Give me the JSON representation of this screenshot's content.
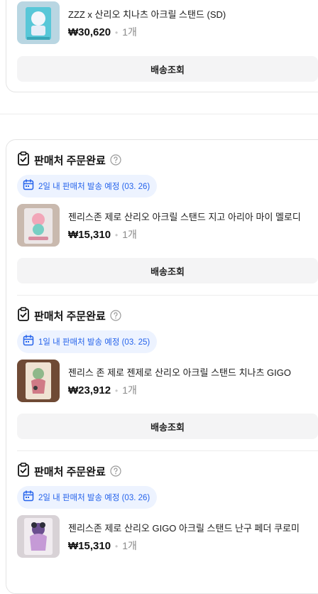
{
  "top_card": {
    "item": {
      "name": "ZZZ x 산리오 치나츠 아크릴 스탠드 (SD)",
      "price": "₩30,620",
      "qty": "1개"
    },
    "track_button": "배송조회"
  },
  "orders": [
    {
      "status": "판매처 주문완료",
      "shipping_note": "2일 내 판매처 발송 예정 (03. 26)",
      "item": {
        "name": "젠리스존 제로 산리오 아크릴 스탠드 지고 아리아 마이 멜로디",
        "price": "₩15,310",
        "qty": "1개"
      },
      "track_button": "배송조회"
    },
    {
      "status": "판매처 주문완료",
      "shipping_note": "1일 내 판매처 발송 예정 (03. 25)",
      "item": {
        "name": "젠리스 존 제로 젠제로 산리오 아크릴 스탠드 치나츠 GIGO",
        "price": "₩23,912",
        "qty": "1개"
      },
      "track_button": "배송조회"
    },
    {
      "status": "판매처 주문완료",
      "shipping_note": "2일 내 판매처 발송 예정 (03. 26)",
      "item": {
        "name": "젠리스존 제로 산리오 GIGO 아크릴 스탠드 난구 페더 쿠로미",
        "price": "₩15,310",
        "qty": "1개"
      }
    }
  ],
  "colors": {
    "accent_blue": "#2563eb",
    "badge_bg": "#edf3ff",
    "button_bg": "#f4f4f5"
  },
  "icons": {
    "status": "clipboard-check-icon",
    "help": "question-circle-icon",
    "shipping": "calendar-icon"
  }
}
